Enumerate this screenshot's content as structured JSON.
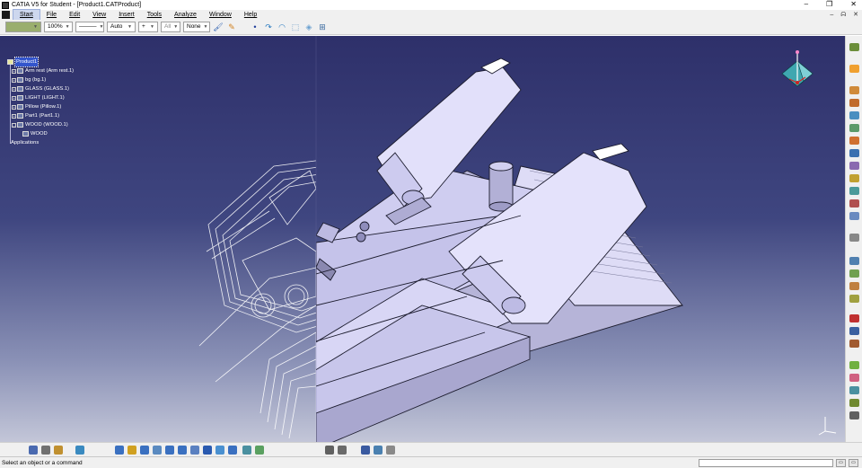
{
  "window": {
    "title": "CATIA V5 for Student - [Product1.CATProduct]",
    "controls": {
      "minimize": "–",
      "maximize": "❐",
      "close": "✕"
    }
  },
  "menubar": {
    "items": [
      "Start",
      "File",
      "Edit",
      "View",
      "Insert",
      "Tools",
      "Analyze",
      "Window",
      "Help"
    ],
    "doc_controls": {
      "minimize": "–",
      "restore": "ᗣ",
      "close": "✕"
    }
  },
  "graphic_properties": {
    "fill_color": "#9aae6e",
    "transparency": "100%",
    "line_type": "———",
    "thickness": "Auto",
    "point_symbol": "+",
    "layer_1": "All",
    "layer_2": "None"
  },
  "spec_tree": {
    "root": "Product1",
    "children": [
      "Arm rest (Arm rest.1)",
      "bg (bg.1)",
      "GLASS (GLASS.1)",
      "LIGHT (LIGHT.1)",
      "Pillow (Pillow.1)",
      "Part1 (Part1.1)",
      "WOOD (WOOD.1)"
    ],
    "sub_child": "WOOD",
    "applications": "Applications"
  },
  "statusbar": {
    "message": "Select an object or a command",
    "command_value": ""
  },
  "colors": {
    "viewport_top": "#2e306a",
    "viewport_bottom": "#c3c6d8",
    "model_fill": "#d5d3f3",
    "model_edge": "#1c1c2e",
    "wireframe": "#ffffff",
    "selection": "#3355cc"
  },
  "icons": {
    "right_toolbar": [
      "sketcher-icon",
      "select-arrow-icon",
      "assembly-icon",
      "constraint-icon",
      "move-icon",
      "explode-icon",
      "analysis-icon",
      "catalog-icon",
      "measure-icon",
      "section-icon",
      "snap-icon",
      "clash-icon",
      "sphere-icon",
      "render-icon"
    ],
    "bottom_toolbar": [
      "fly-icon",
      "fit-all-icon",
      "pan-icon",
      "rotate-icon",
      "zoom-in-icon",
      "zoom-out-icon",
      "normal-view-icon",
      "iso-view-icon",
      "shading-icon",
      "hide-show-icon",
      "swap-space-icon",
      "formula-icon",
      "comment-icon",
      "table-icon",
      "apply-material-icon"
    ]
  }
}
